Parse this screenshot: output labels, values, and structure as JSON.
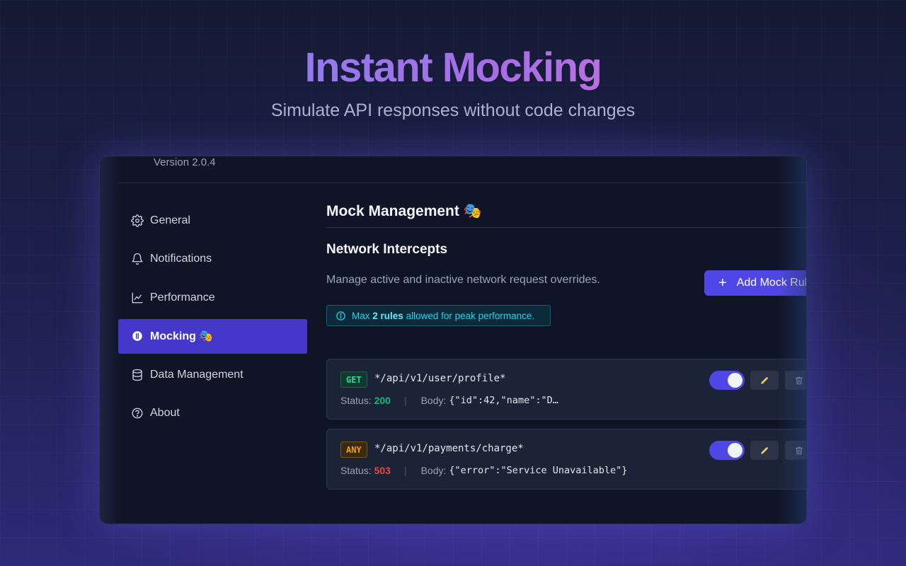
{
  "hero": {
    "title": "Instant Mocking",
    "subtitle": "Simulate API responses without code changes"
  },
  "app": {
    "version": "Version 2.0.4"
  },
  "sidebar": {
    "items": [
      {
        "label": "General",
        "icon": "gear-icon",
        "active": false
      },
      {
        "label": "Notifications",
        "icon": "bell-icon",
        "active": false
      },
      {
        "label": "Performance",
        "icon": "line-chart-icon",
        "active": false
      },
      {
        "label": "Mocking 🎭",
        "icon": "mocking-icon",
        "active": true
      },
      {
        "label": "Data Management",
        "icon": "database-icon",
        "active": false
      },
      {
        "label": "About",
        "icon": "help-circle-icon",
        "active": false
      }
    ]
  },
  "main": {
    "title": "Mock Management 🎭",
    "section_title": "Network Intercepts",
    "section_description": "Manage active and inactive network request overrides.",
    "add_button_label": "Add Mock Rule",
    "info": {
      "prefix": "Max",
      "highlight": "2 rules",
      "suffix": "allowed for peak performance."
    },
    "rules": [
      {
        "method": "GET",
        "url": "*/api/v1/user/profile*",
        "status_label": "Status:",
        "status": "200",
        "body_label": "Body:",
        "body": "{\"id\":42,\"name\":\"D…",
        "enabled": true
      },
      {
        "method": "ANY",
        "url": "*/api/v1/payments/charge*",
        "status_label": "Status:",
        "status": "503",
        "body_label": "Body:",
        "body": "{\"error\":\"Service Unavailable\"}",
        "enabled": true
      }
    ]
  },
  "colors": {
    "accent": "#4f46e5",
    "active_nav": "#4338ca",
    "status_ok": "#10b981",
    "status_error": "#ef4444",
    "info": "#22d3ee"
  }
}
